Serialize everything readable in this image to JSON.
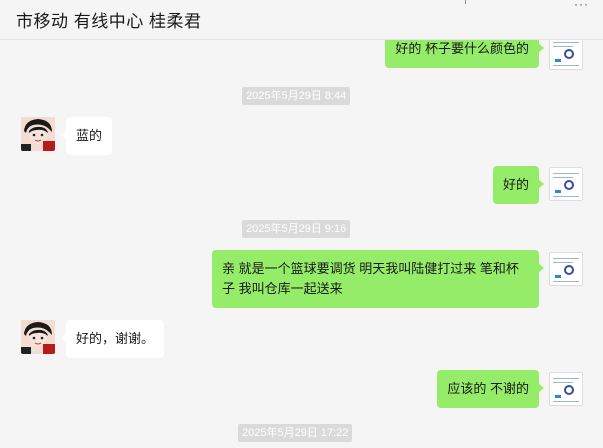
{
  "header": {
    "title": "市移动 有线中心 桂柔君",
    "more": "···"
  },
  "messages": [
    {
      "kind": "out",
      "text": "好的 杯子要什么颜色的"
    },
    {
      "kind": "time",
      "text": "2025年5月29日 8:44"
    },
    {
      "kind": "in",
      "text": "蓝的"
    },
    {
      "kind": "out",
      "text": "好的"
    },
    {
      "kind": "time",
      "text": "2025年5月29日 9:16"
    },
    {
      "kind": "out",
      "text": "亲 就是一个篮球要调货 明天我叫陆健打过来 笔和杯子 我叫仓库一起送来"
    },
    {
      "kind": "in",
      "text": "好的，谢谢。"
    },
    {
      "kind": "out",
      "text": "应该的 不谢的"
    },
    {
      "kind": "time",
      "text": "2025年5月29日 17:22"
    }
  ]
}
